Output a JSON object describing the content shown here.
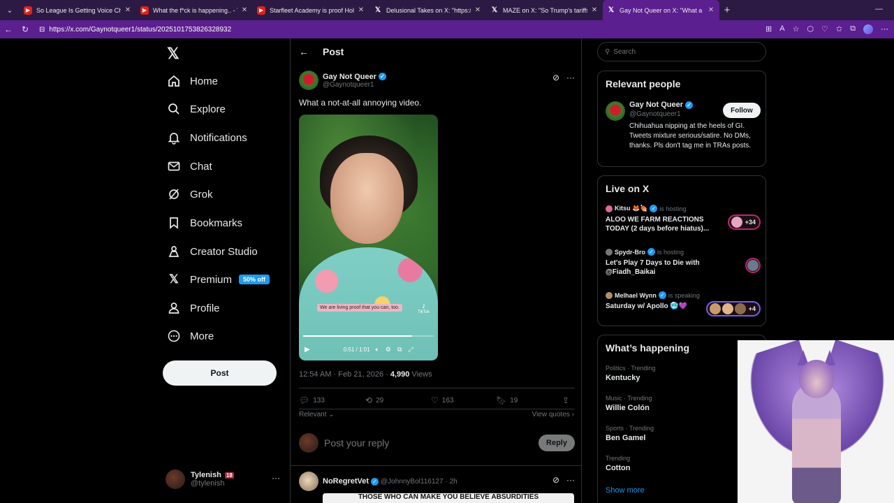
{
  "browser": {
    "tabs": [
      {
        "title": "So League Is Getting Voice Chat...",
        "icon": "youtube-icon",
        "active": false
      },
      {
        "title": "What the f*ck is happening.. - You",
        "icon": "youtube-icon",
        "active": false
      },
      {
        "title": "Starfleet Academy is proof Hollyw",
        "icon": "youtube-icon",
        "active": false
      },
      {
        "title": "Delusional Takes on X: \"https://t.c",
        "icon": "x-icon",
        "active": false
      },
      {
        "title": "MAZE on X: \"So Trump's tariffs are",
        "icon": "x-icon",
        "active": false
      },
      {
        "title": "Gay Not Queer on X: \"What a not-",
        "icon": "x-icon",
        "active": true
      }
    ],
    "url": "https://x.com/Gaynotqueer1/status/2025101753826328932"
  },
  "nav": {
    "items": [
      {
        "label": "Home",
        "icon": "home-icon"
      },
      {
        "label": "Explore",
        "icon": "search-icon"
      },
      {
        "label": "Notifications",
        "icon": "bell-icon"
      },
      {
        "label": "Chat",
        "icon": "mail-icon"
      },
      {
        "label": "Grok",
        "icon": "grok-icon"
      },
      {
        "label": "Bookmarks",
        "icon": "bookmark-icon"
      },
      {
        "label": "Creator Studio",
        "icon": "creator-icon"
      },
      {
        "label": "Premium",
        "icon": "x-icon"
      },
      {
        "label": "Profile",
        "icon": "person-icon"
      },
      {
        "label": "More",
        "icon": "more-circle-icon"
      }
    ],
    "premium_badge": "50% off",
    "post_button": "Post",
    "me": {
      "name": "Tylenish",
      "badge": "18",
      "handle": "@tylenish"
    }
  },
  "post": {
    "header_title": "Post",
    "author_name": "Gay Not Queer",
    "author_handle": "@Gaynotqueer1",
    "text": "What a not-at-all annoying video.",
    "video": {
      "caption": "We are living proof that you can, too.",
      "watermark": "TikTok",
      "time": "0:51 / 1:01",
      "progress": 0.836
    },
    "timestamp": "12:54 AM · Feb 21, 2026 · ",
    "views_count": "4,990",
    "views_label": " Views",
    "stats": {
      "replies": "133",
      "reposts": "29",
      "likes": "163",
      "bookmarks": "19"
    },
    "sort_label": "Relevant",
    "view_quotes": "View quotes",
    "reply_placeholder": "Post your reply",
    "reply_button": "Reply"
  },
  "next_tweet": {
    "name": "NoRegretVet",
    "handle": "@JohnnyBol116127",
    "age": "· 2h",
    "media_text": "THOSE WHO CAN MAKE YOU BELIEVE ABSURDITIES"
  },
  "sidebar": {
    "search_placeholder": "Search",
    "relevant_title": "Relevant people",
    "relevant_person": {
      "name": "Gay Not Queer",
      "handle": "@Gaynotqueer1",
      "follow_label": "Follow",
      "bio": "Chihuahua nipping at the heels of GI. Tweets mixture serious/satire. No DMs, thanks. Pls don't tag me in TRAs posts."
    },
    "live_title": "Live on X",
    "live": [
      {
        "host": "Kitsu 🦊🍖",
        "state": "is hosting",
        "title": "ALOO WE FARM REACTIONS TODAY  (2 days before hiatus)...",
        "count": "+34"
      },
      {
        "host": "Spydr-Bro",
        "state": "is hosting",
        "title": "Let's Play 7 Days to Die with @Fiadh_Baikai",
        "count": ""
      },
      {
        "host": "Melhael Wynn",
        "state": "is speaking",
        "title": "Saturday w/ Apollo 🥶💜",
        "count": "+4"
      }
    ],
    "happening_title": "What’s happening",
    "trends": [
      {
        "category": "Politics · Trending",
        "name": "Kentucky"
      },
      {
        "category": "Music · Trending",
        "name": "Willie Colón"
      },
      {
        "category": "Sports · Trending",
        "name": "Ben Gamel"
      },
      {
        "category": "Trending",
        "name": "Cotton"
      }
    ],
    "show_more": "Show more"
  },
  "colors": {
    "accent": "#1d9bf0",
    "browser": "#5b1f8f",
    "background": "#000000"
  }
}
